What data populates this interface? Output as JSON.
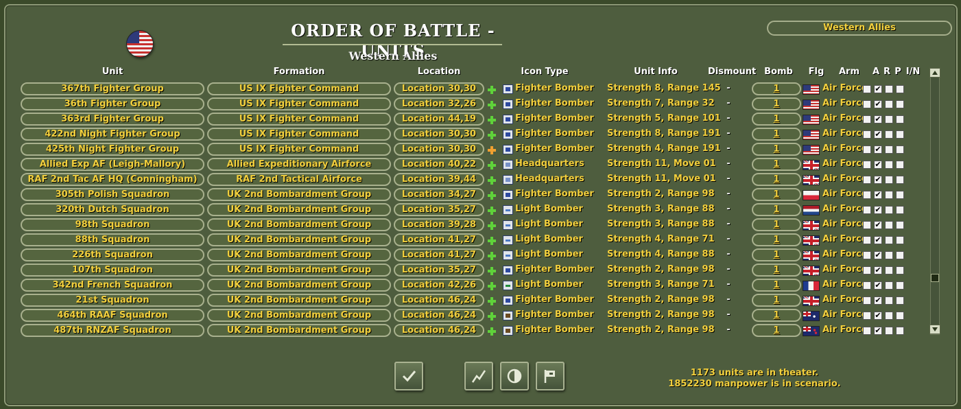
{
  "header": {
    "title": "ORDER OF BATTLE - UNITS",
    "subtitle": "Western Allies",
    "side_selector": "Western Allies"
  },
  "columns": {
    "unit": "Unit",
    "formation": "Formation",
    "location": "Location",
    "icon_type": "Icon Type",
    "unit_info": "Unit Info",
    "dismount": "Dismount",
    "bomb": "Bomb",
    "flg": "Flg",
    "arm": "Arm",
    "a": "A",
    "r": "R",
    "p": "P",
    "in": "I/N"
  },
  "rows": [
    {
      "unit": "367th Fighter Group",
      "formation": "US IX Fighter Command",
      "location": "Location 30,30",
      "plus": "green",
      "icon": "fighter-bomber",
      "icon_type": "Fighter Bomber",
      "info": "Strength 8, Range 145",
      "dismount": "-",
      "bomb": "1",
      "flag": "us",
      "arm": "Air Force",
      "a": false,
      "r": true,
      "p": false,
      "n": false
    },
    {
      "unit": "36th Fighter Group",
      "formation": "US IX Fighter Command",
      "location": "Location 32,26",
      "plus": "green",
      "icon": "fighter-bomber",
      "icon_type": "Fighter Bomber",
      "info": "Strength 7, Range 32",
      "dismount": "-",
      "bomb": "1",
      "flag": "us",
      "arm": "Air Force",
      "a": false,
      "r": true,
      "p": false,
      "n": false
    },
    {
      "unit": "363rd Fighter Group",
      "formation": "US IX Fighter Command",
      "location": "Location 44,19",
      "plus": "green",
      "icon": "fighter-bomber",
      "icon_type": "Fighter Bomber",
      "info": "Strength 5, Range 101",
      "dismount": "-",
      "bomb": "1",
      "flag": "us",
      "arm": "Air Force",
      "a": false,
      "r": true,
      "p": false,
      "n": false
    },
    {
      "unit": "422nd Night Fighter Group",
      "formation": "US IX Fighter Command",
      "location": "Location 30,30",
      "plus": "green",
      "icon": "fighter-bomber",
      "icon_type": "Fighter Bomber",
      "info": "Strength 8, Range 191",
      "dismount": "-",
      "bomb": "1",
      "flag": "us",
      "arm": "Air Force",
      "a": false,
      "r": true,
      "p": false,
      "n": false
    },
    {
      "unit": "425th Night Fighter Group",
      "formation": "US IX Fighter Command",
      "location": "Location 30,30",
      "plus": "orange",
      "icon": "fighter-bomber",
      "icon_type": "Fighter Bomber",
      "info": "Strength 4, Range 191",
      "dismount": "-",
      "bomb": "1",
      "flag": "us",
      "arm": "Air Force",
      "a": false,
      "r": true,
      "p": false,
      "n": false
    },
    {
      "unit": "Allied Exp AF (Leigh-Mallory)",
      "formation": "Allied Expeditionary Airforce",
      "location": "Location 40,22",
      "plus": "green",
      "icon": "headquarters",
      "icon_type": "Headquarters",
      "info": "Strength 11, Move 01",
      "dismount": "-",
      "bomb": "1",
      "flag": "uk",
      "arm": "Air Force",
      "a": false,
      "r": true,
      "p": false,
      "n": false
    },
    {
      "unit": "RAF 2nd Tac AF HQ (Conningham)",
      "formation": "RAF 2nd Tactical Airforce",
      "location": "Location 39,44",
      "plus": "green",
      "icon": "headquarters",
      "icon_type": "Headquarters",
      "info": "Strength 11, Move 01",
      "dismount": "-",
      "bomb": "1",
      "flag": "uk",
      "arm": "Air Force",
      "a": false,
      "r": true,
      "p": false,
      "n": false
    },
    {
      "unit": "305th Polish Squadron",
      "formation": "UK 2nd Bombardment Group",
      "location": "Location 34,27",
      "plus": "green",
      "icon": "fighter-bomber",
      "icon_type": "Fighter Bomber",
      "info": "Strength 2, Range 98",
      "dismount": "-",
      "bomb": "1",
      "flag": "pl",
      "arm": "Air Force",
      "a": false,
      "r": true,
      "p": false,
      "n": false
    },
    {
      "unit": "320th Dutch Squadron",
      "formation": "UK 2nd Bombardment Group",
      "location": "Location 35,27",
      "plus": "green",
      "icon": "light-bomber",
      "icon_type": "Light Bomber",
      "info": "Strength 3, Range 88",
      "dismount": "-",
      "bomb": "1",
      "flag": "nl",
      "arm": "Air Force",
      "a": false,
      "r": true,
      "p": false,
      "n": false
    },
    {
      "unit": "98th Squadron",
      "formation": "UK 2nd Bombardment Group",
      "location": "Location 39,28",
      "plus": "green",
      "icon": "light-bomber",
      "icon_type": "Light Bomber",
      "info": "Strength 3, Range 88",
      "dismount": "-",
      "bomb": "1",
      "flag": "uk",
      "arm": "Air Force",
      "a": false,
      "r": true,
      "p": false,
      "n": false
    },
    {
      "unit": "88th Squadron",
      "formation": "UK 2nd Bombardment Group",
      "location": "Location 41,27",
      "plus": "green",
      "icon": "light-bomber",
      "icon_type": "Light Bomber",
      "info": "Strength 4, Range 71",
      "dismount": "-",
      "bomb": "1",
      "flag": "uk",
      "arm": "Air Force",
      "a": false,
      "r": true,
      "p": false,
      "n": false
    },
    {
      "unit": "226th Squadron",
      "formation": "UK 2nd Bombardment Group",
      "location": "Location 41,27",
      "plus": "green",
      "icon": "light-bomber",
      "icon_type": "Light Bomber",
      "info": "Strength 4, Range 88",
      "dismount": "-",
      "bomb": "1",
      "flag": "uk",
      "arm": "Air Force",
      "a": false,
      "r": true,
      "p": false,
      "n": false
    },
    {
      "unit": "107th Squadron",
      "formation": "UK 2nd Bombardment Group",
      "location": "Location 35,27",
      "plus": "green",
      "icon": "fighter-bomber",
      "icon_type": "Fighter Bomber",
      "info": "Strength 2, Range 98",
      "dismount": "-",
      "bomb": "1",
      "flag": "uk",
      "arm": "Air Force",
      "a": false,
      "r": true,
      "p": false,
      "n": false
    },
    {
      "unit": "342nd French Squadron",
      "formation": "UK 2nd Bombardment Group",
      "location": "Location 42,26",
      "plus": "green",
      "icon": "light-bomber-green",
      "icon_type": "Light Bomber",
      "info": "Strength 3, Range 71",
      "dismount": "-",
      "bomb": "1",
      "flag": "fr",
      "arm": "Air Force",
      "a": false,
      "r": true,
      "p": false,
      "n": false
    },
    {
      "unit": "21st Squadron",
      "formation": "UK 2nd Bombardment Group",
      "location": "Location 46,24",
      "plus": "green",
      "icon": "fighter-bomber",
      "icon_type": "Fighter Bomber",
      "info": "Strength 2, Range 98",
      "dismount": "-",
      "bomb": "1",
      "flag": "uk",
      "arm": "Air Force",
      "a": false,
      "r": true,
      "p": false,
      "n": false
    },
    {
      "unit": "464th RAAF Squadron",
      "formation": "UK 2nd Bombardment Group",
      "location": "Location 46,24",
      "plus": "green",
      "icon": "fighter-bomber-brown",
      "icon_type": "Fighter Bomber",
      "info": "Strength 2, Range 98",
      "dismount": "-",
      "bomb": "1",
      "flag": "au",
      "arm": "Air Force",
      "a": false,
      "r": true,
      "p": false,
      "n": false
    },
    {
      "unit": "487th RNZAF Squadron",
      "formation": "UK 2nd Bombardment Group",
      "location": "Location 46,24",
      "plus": "green",
      "icon": "fighter-bomber-brown",
      "icon_type": "Fighter Bomber",
      "info": "Strength 2, Range 98",
      "dismount": "-",
      "bomb": "1",
      "flag": "nz",
      "arm": "Air Force",
      "a": false,
      "r": true,
      "p": false,
      "n": false
    }
  ],
  "footer": {
    "units_text": "1173 units are in theater.",
    "manpower_text": "1852230 manpower is in scenario."
  },
  "buttons": {
    "ok": "checkmark-icon",
    "chart": "chart-icon",
    "contrast": "half-circle-icon",
    "flag": "flag-icon"
  },
  "colors": {
    "panel": "#4e5d3e",
    "accent_text": "#f2cf3c",
    "pill_border": "#a9b18e"
  }
}
